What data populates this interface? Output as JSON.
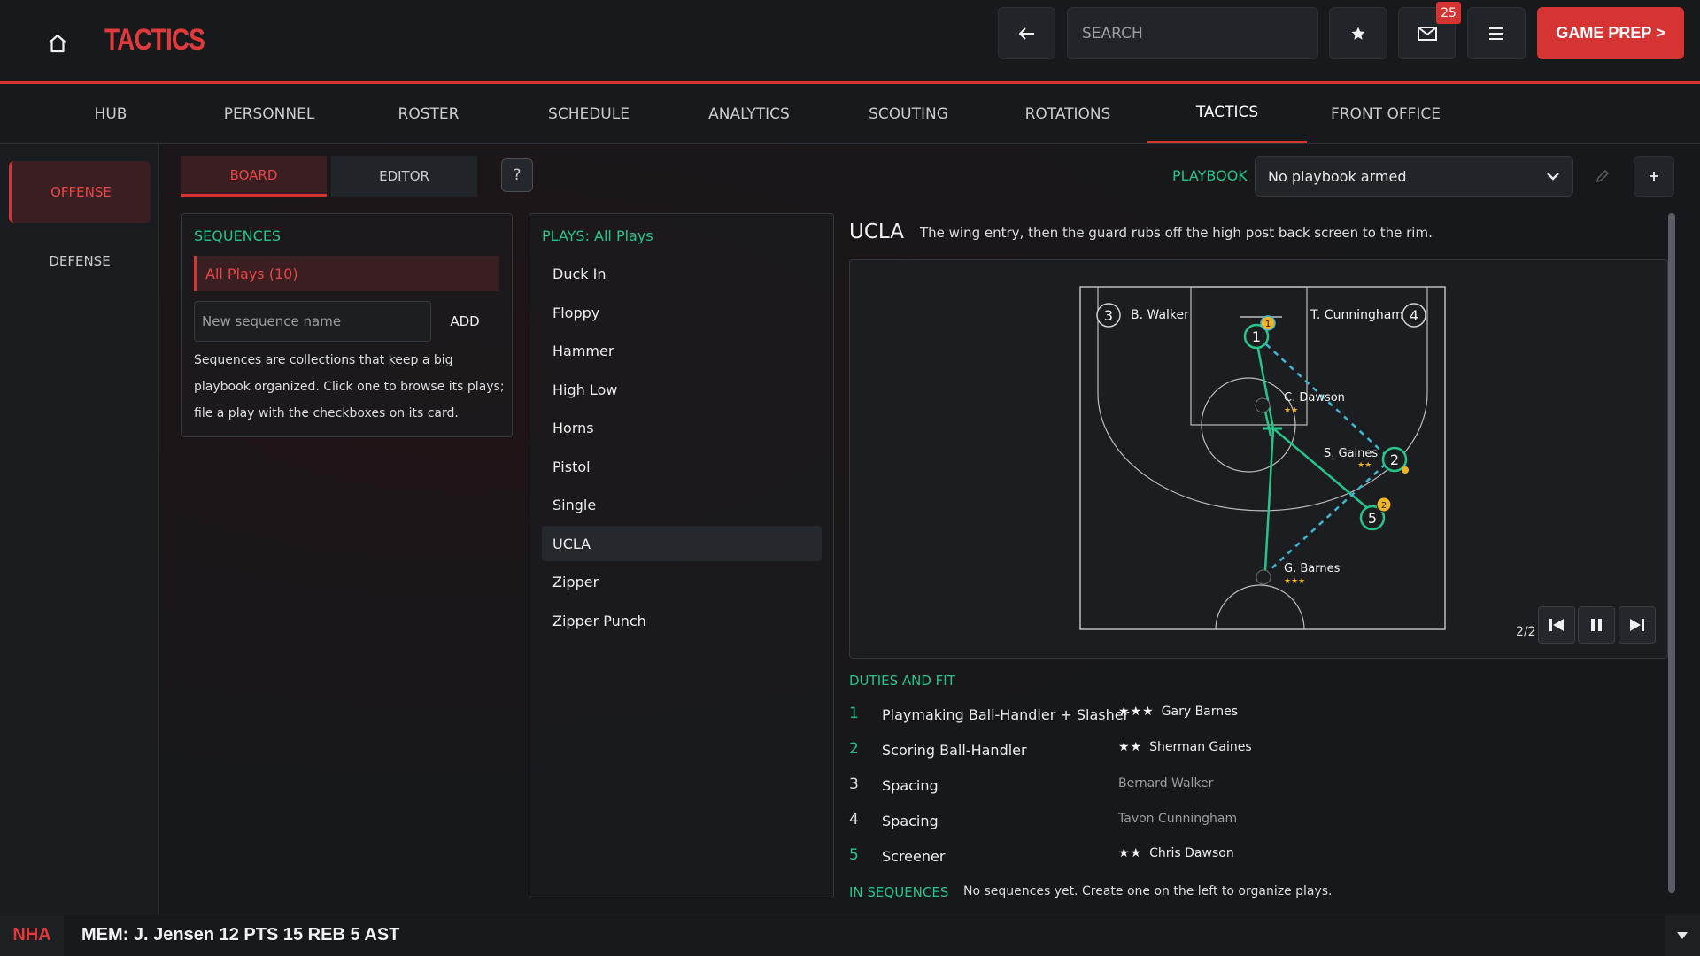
{
  "header": {
    "title": "TACTICS",
    "search_placeholder": "SEARCH",
    "notification_count": "25",
    "game_prep_label": "GAME PREP >",
    "icons": [
      "home-icon",
      "back-arrow-icon",
      "star-icon",
      "mail-icon",
      "menu-icon"
    ]
  },
  "nav": {
    "tabs": [
      {
        "label": "HUB"
      },
      {
        "label": "PERSONNEL"
      },
      {
        "label": "ROSTER"
      },
      {
        "label": "SCHEDULE"
      },
      {
        "label": "ANALYTICS"
      },
      {
        "label": "SCOUTING"
      },
      {
        "label": "ROTATIONS"
      },
      {
        "label": "TACTICS",
        "active": true
      },
      {
        "label": "FRONT OFFICE"
      }
    ]
  },
  "sidenav": {
    "items": [
      {
        "label": "OFFENSE",
        "active": true
      },
      {
        "label": "DEFENSE"
      }
    ]
  },
  "toolbar": {
    "board_label": "BOARD",
    "editor_label": "EDITOR",
    "help_label": "?",
    "playbook_label": "PLAYBOOK",
    "playbook_value": "No playbook armed"
  },
  "sequences": {
    "heading": "SEQUENCES",
    "selected": "All Plays  (10)",
    "input_placeholder": "New sequence name",
    "add_label": "ADD",
    "help_text": "Sequences are collections that keep a big playbook organized. Click one to browse its plays; file a play with the checkboxes on its card."
  },
  "plays": {
    "heading": "PLAYS: All Plays",
    "items": [
      "Duck In",
      "Floppy",
      "Hammer",
      "High Low",
      "Horns",
      "Pistol",
      "Single",
      "UCLA",
      "Zipper",
      "Zipper Punch"
    ],
    "selected_index": 7
  },
  "detail": {
    "name": "UCLA",
    "description": "The wing entry, then the guard rubs off the high post back screen to the rim.",
    "board": {
      "players": [
        {
          "num": "1",
          "name": ""
        },
        {
          "num": "2",
          "name": "S. Gaines",
          "stars": "★★"
        },
        {
          "num": "3",
          "name": "B. Walker"
        },
        {
          "num": "4",
          "name": "T. Cunningham"
        },
        {
          "num": "5",
          "name": ""
        },
        {
          "num": "",
          "name": "C. Dawson",
          "stars": "★★"
        },
        {
          "num": "",
          "name": "G. Barnes",
          "stars": "★★★"
        }
      ],
      "ball_markers": [
        "1",
        "2"
      ],
      "step": "2/2",
      "colors": {
        "accent": "#27c48a",
        "pass": "#3cb8d6",
        "ball": "#f0b429",
        "court": "#bdbdbd"
      }
    },
    "duties_heading": "DUTIES AND FIT",
    "duties": [
      {
        "num": "1",
        "role": "Playmaking Ball-Handler + Slasher",
        "stars": "★★★",
        "player": "Gary Barnes"
      },
      {
        "num": "2",
        "role": "Scoring Ball-Handler",
        "stars": "★★",
        "player": "Sherman Gaines"
      },
      {
        "num": "3",
        "role": "Spacing",
        "stars": "",
        "player": "Bernard Walker"
      },
      {
        "num": "4",
        "role": "Spacing",
        "stars": "",
        "player": "Tavon Cunningham"
      },
      {
        "num": "5",
        "role": "Screener",
        "stars": "★★",
        "player": "Chris Dawson"
      }
    ],
    "in_sequences_label": "IN SEQUENCES",
    "in_sequences_text": "No sequences yet. Create one on the left to organize plays."
  },
  "ticker": {
    "league": "NHA",
    "text": "MEM: J. Jensen 12 PTS 15 REB 5 AST"
  },
  "colors": {
    "brand_red": "#d63333",
    "accent_green": "#27c48a",
    "background": "#16181b"
  }
}
